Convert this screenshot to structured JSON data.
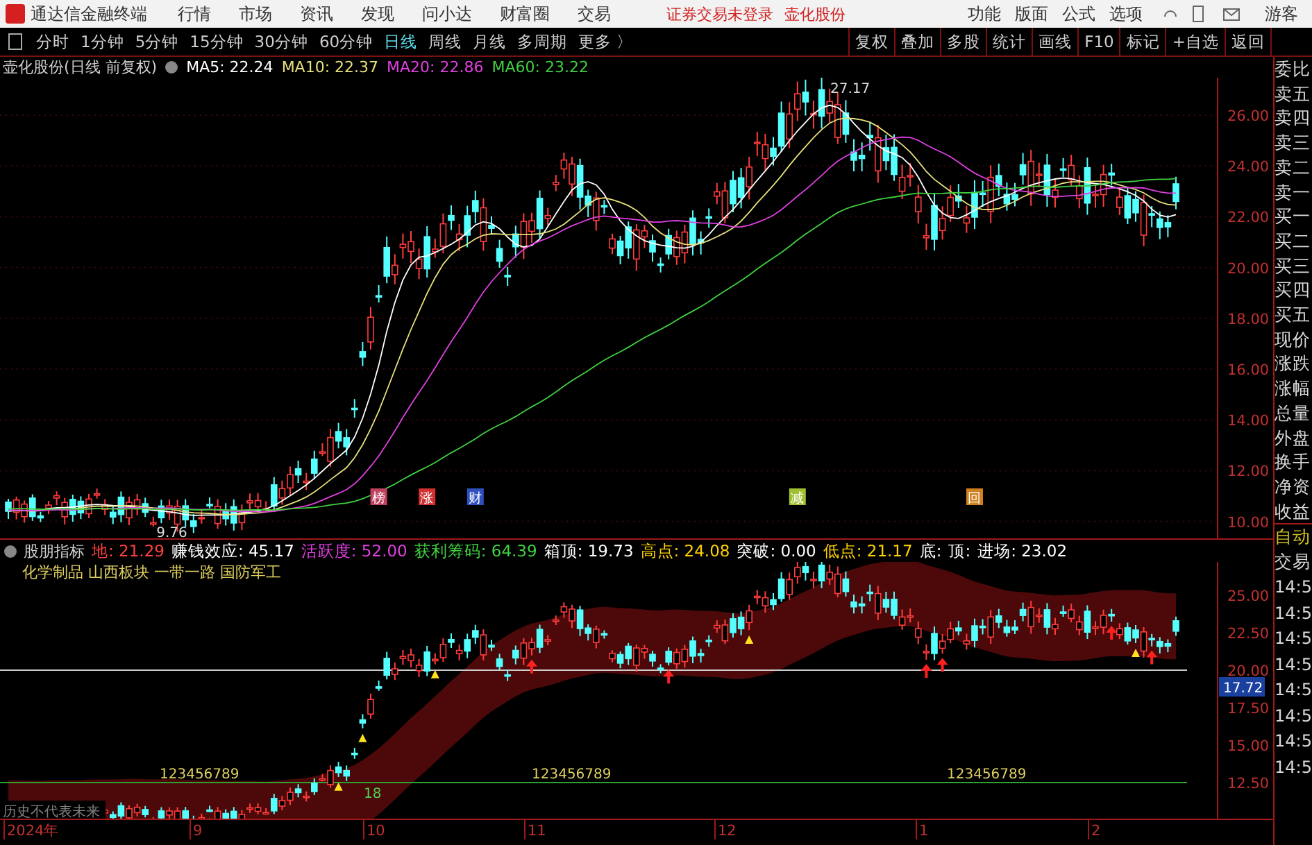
{
  "app_bar": {
    "title": "通达信金融终端",
    "menu": [
      "行情",
      "市场",
      "资讯",
      "发现",
      "问小达",
      "财富圈",
      "交易"
    ],
    "login_status": "证券交易未登录",
    "stock_name": "壶化股份",
    "tools": [
      "功能",
      "版面",
      "公式",
      "选项"
    ],
    "user": "游客"
  },
  "period_tabs": [
    {
      "label": "分时",
      "selected": false
    },
    {
      "label": "1分钟",
      "selected": false
    },
    {
      "label": "5分钟",
      "selected": false
    },
    {
      "label": "15分钟",
      "selected": false
    },
    {
      "label": "30分钟",
      "selected": false
    },
    {
      "label": "60分钟",
      "selected": false
    },
    {
      "label": "日线",
      "selected": true
    },
    {
      "label": "周线",
      "selected": false
    },
    {
      "label": "月线",
      "selected": false
    },
    {
      "label": "多周期",
      "selected": false
    },
    {
      "label": "更多 〉",
      "selected": false
    }
  ],
  "chart_actions": [
    "复权",
    "叠加",
    "多股",
    "统计",
    "画线",
    "F10",
    "标记",
    "+自选",
    "返回"
  ],
  "main_chart": {
    "title": "壶化股份(日线 前复权)",
    "ma": [
      {
        "label": "MA5: 22.24",
        "color": "#ffffff"
      },
      {
        "label": "MA10: 22.37",
        "color": "#e6e07a"
      },
      {
        "label": "MA20: 22.86",
        "color": "#e040e0"
      },
      {
        "label": "MA60: 23.22",
        "color": "#40d040"
      }
    ],
    "high_label": "27.17",
    "low_label": "9.76",
    "yticks": [
      "26.00",
      "24.00",
      "22.00",
      "20.00",
      "18.00",
      "16.00",
      "14.00",
      "12.00",
      "10.00"
    ],
    "events": [
      {
        "label": "榜",
        "color": "#c04060"
      },
      {
        "label": "涨",
        "color": "#d03030"
      },
      {
        "label": "财",
        "color": "#3050c0"
      },
      {
        "label": "减",
        "color": "#a0c030"
      },
      {
        "label": "回",
        "color": "#d08020"
      }
    ]
  },
  "indicator": {
    "name": "股朋指标",
    "readings": [
      {
        "label": "地: 21.29",
        "color": "#ff4040"
      },
      {
        "label": "赚钱效应: 45.17",
        "color": "#ffffff"
      },
      {
        "label": "活跃度: 52.00",
        "color": "#e040e0"
      },
      {
        "label": "获利筹码: 64.39",
        "color": "#40d040"
      },
      {
        "label": "箱顶: 19.73",
        "color": "#ffffff"
      },
      {
        "label": "高点: 24.08",
        "color": "#ffd000"
      },
      {
        "label": "突破: 0.00",
        "color": "#ffffff"
      },
      {
        "label": "低点: 21.17",
        "color": "#ffd000"
      },
      {
        "label": "底:",
        "color": "#ffffff"
      },
      {
        "label": "顶:",
        "color": "#ffffff"
      },
      {
        "label": "进场: 23.02",
        "color": "#ffffff"
      }
    ],
    "sectors": "化学制品 山西板块 一带一路 国防军工",
    "counters": [
      "123456789",
      "18",
      "123456789",
      "123456789"
    ],
    "disclaimer": "历史不代表未来",
    "yticks": [
      "25.00",
      "22.50",
      "20.00",
      "17.50",
      "15.00",
      "12.50"
    ],
    "price_tag": "17.72"
  },
  "x_axis": [
    "2024年",
    "9",
    "10",
    "11",
    "12",
    "1",
    "2"
  ],
  "side_panel": {
    "items": [
      "委比",
      "卖五",
      "卖四",
      "卖三",
      "卖二",
      "卖一",
      "买一",
      "买二",
      "买三",
      "买四",
      "买五",
      "现价",
      "涨跌",
      "涨幅",
      "总量",
      "外盘",
      "换手",
      "净资",
      "收益"
    ],
    "modes": [
      "自动",
      "交易"
    ],
    "times": [
      "14:5",
      "14:5",
      "14:5",
      "14:5",
      "14:5",
      "14:5",
      "14:5",
      "14:5"
    ]
  }
}
